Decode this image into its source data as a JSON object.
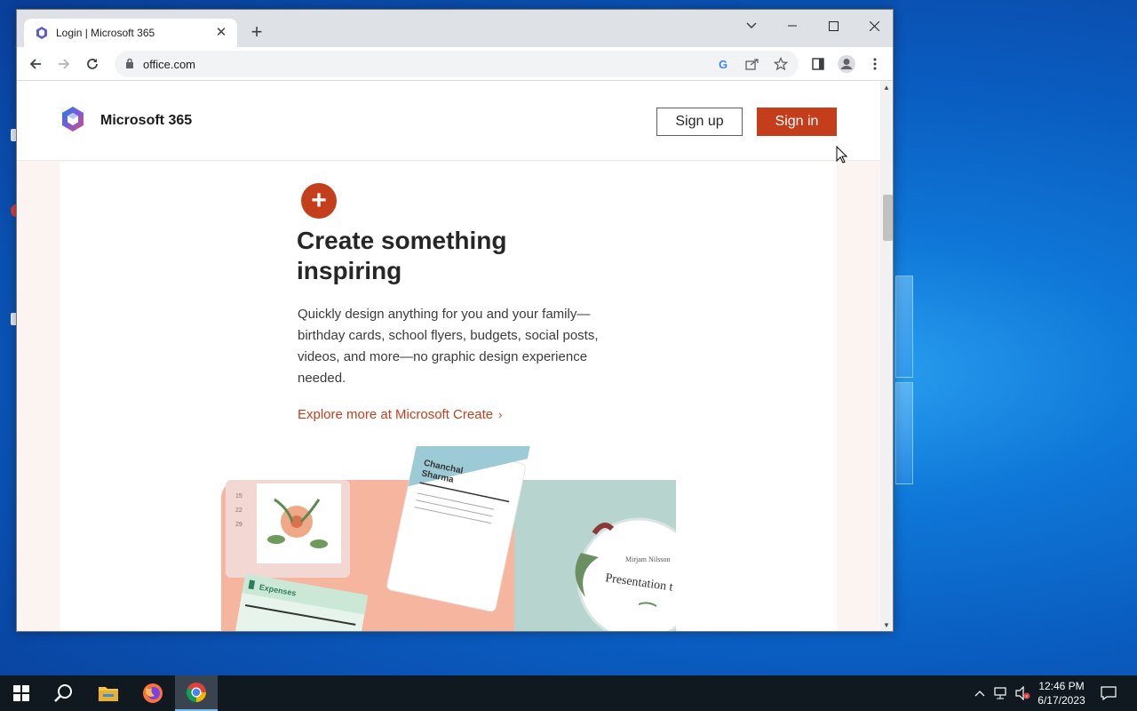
{
  "browser": {
    "tab_title": "Login | Microsoft 365",
    "url": "office.com"
  },
  "site": {
    "brand_name": "Microsoft 365",
    "signup_label": "Sign up",
    "signin_label": "Sign in"
  },
  "feature": {
    "headline": "Create something inspiring",
    "description": "Quickly design anything for you and your family—birthday cards, school flyers, budgets, social posts, videos, and more—no graphic design experience needed.",
    "link_text": "Explore more at Microsoft Create",
    "link_chevron": "›"
  },
  "hero_image": {
    "resume_name_line1": "Chanchal",
    "resume_name_line2": "Sharma",
    "expenses_label": "Expenses",
    "presentation_label": "Presentation t",
    "presenter_name": "Mirjam Nilsson",
    "calendar_numbers": [
      "15",
      "22",
      "29"
    ]
  },
  "taskbar": {
    "time": "12:46 PM",
    "date": "6/17/2023"
  },
  "colors": {
    "accent": "#c43e1c",
    "desktop": "#0f78d8"
  }
}
